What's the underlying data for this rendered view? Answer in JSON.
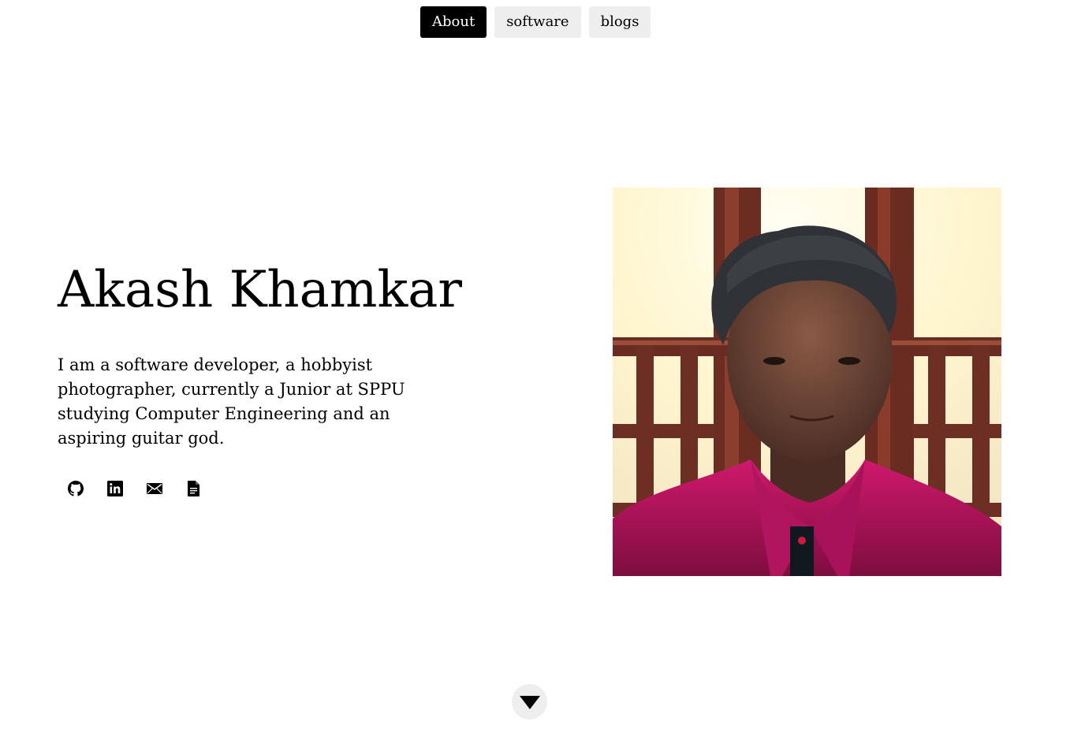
{
  "nav": {
    "items": [
      {
        "label": "About",
        "active": true
      },
      {
        "label": "software",
        "active": false
      },
      {
        "label": "blogs",
        "active": false
      }
    ]
  },
  "intro": {
    "name": "Akash Khamkar",
    "bio": "I am a software developer, a hobbyist photographer, currently a Junior at SPPU studying Computer Engineering and an aspiring guitar god."
  },
  "socials": [
    {
      "icon": "github-icon"
    },
    {
      "icon": "linkedin-icon"
    },
    {
      "icon": "mail-icon"
    },
    {
      "icon": "document-icon"
    }
  ],
  "photo": {
    "subject": "portrait-photo"
  },
  "scroll": {
    "icon": "triangle-down-icon"
  },
  "colors": {
    "nav_active_bg": "#000000",
    "nav_inactive_bg": "#eeeeee",
    "shirt": "#c2185b"
  }
}
